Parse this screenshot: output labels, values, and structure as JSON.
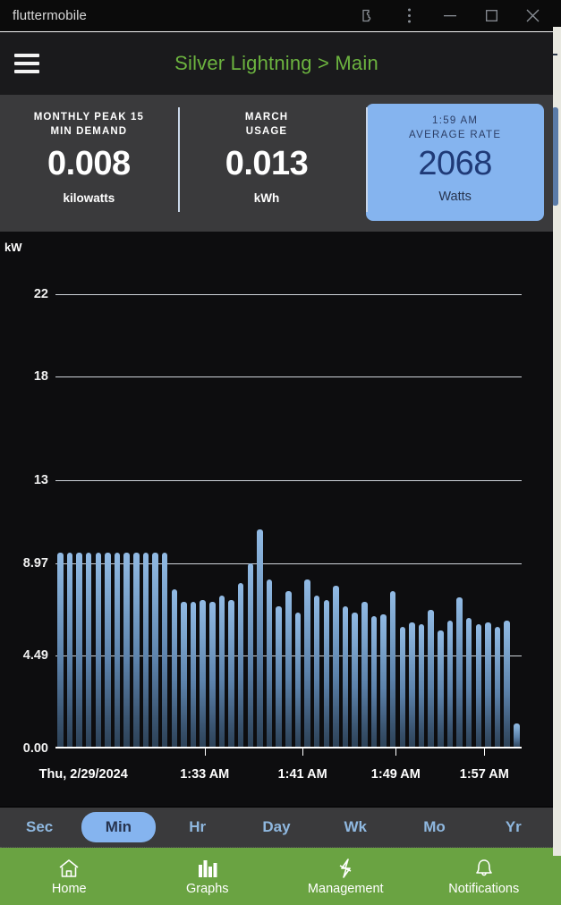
{
  "titlebar": {
    "app_name": "fluttermobile",
    "buttons": [
      {
        "name": "extension-icon",
        "label": ""
      },
      {
        "name": "more-vertical-icon",
        "label": ""
      },
      {
        "name": "minimize-button",
        "label": ""
      },
      {
        "name": "maximize-button",
        "label": ""
      },
      {
        "name": "close-button",
        "label": ""
      }
    ]
  },
  "appbar": {
    "title": "Silver Lightning > Main",
    "title_color": "#6cb33f",
    "menu_icon": "hamburger-icon"
  },
  "stats": [
    {
      "label": "MONTHLY PEAK 15\nMIN DEMAND",
      "label_line1": "MONTHLY PEAK 15",
      "label_line2": "MIN DEMAND",
      "value": "0.008",
      "unit": "kilowatts",
      "highlighted": false
    },
    {
      "label_line1": "MARCH",
      "label_line2": "USAGE",
      "value": "0.013",
      "unit": "kWh",
      "highlighted": false
    },
    {
      "label_line1": "1:59 AM",
      "label_line2": "AVERAGE RATE",
      "value": "2068",
      "unit": "Watts",
      "highlighted": true,
      "bg_color": "#85b4ef"
    }
  ],
  "chart_data": {
    "type": "bar",
    "title": "",
    "xlabel": "",
    "ylabel": "kW",
    "ylim": [
      0,
      24.5
    ],
    "grid": true,
    "legend": null,
    "bar_color": "#8fb8e0",
    "ytick_labels": [
      "22",
      "18",
      "13",
      "8.97",
      "4.49",
      "0.00"
    ],
    "ytick_values": [
      22,
      18,
      13,
      8.97,
      4.49,
      0.0
    ],
    "xtick_labels": [
      "Thu, 2/29/2024",
      "1:33 AM",
      "1:41 AM",
      "1:49 AM",
      "1:57 AM"
    ],
    "xtick_positions": [
      0.06,
      0.32,
      0.53,
      0.73,
      0.92
    ],
    "values": [
      9.5,
      9.5,
      9.5,
      9.5,
      9.5,
      9.5,
      9.5,
      9.5,
      9.5,
      9.5,
      9.5,
      9.5,
      7.7,
      7.1,
      7.1,
      7.2,
      7.1,
      7.4,
      7.2,
      8.0,
      8.97,
      10.6,
      8.2,
      6.9,
      7.6,
      6.6,
      8.2,
      7.4,
      7.2,
      7.9,
      6.9,
      6.6,
      7.1,
      6.4,
      6.5,
      7.6,
      5.9,
      6.1,
      6.0,
      6.7,
      5.7,
      6.2,
      7.3,
      6.3,
      6.0,
      6.1,
      5.9,
      6.2,
      1.2
    ]
  },
  "ranges": [
    {
      "label": "Sec",
      "active": false
    },
    {
      "label": "Min",
      "active": true
    },
    {
      "label": "Hr",
      "active": false
    },
    {
      "label": "Day",
      "active": false
    },
    {
      "label": "Wk",
      "active": false
    },
    {
      "label": "Mo",
      "active": false
    },
    {
      "label": "Yr",
      "active": false
    }
  ],
  "bottom_nav": [
    {
      "label": "Home",
      "icon": "home-icon",
      "active": false
    },
    {
      "label": "Graphs",
      "icon": "bar-chart-icon",
      "active": true
    },
    {
      "label": "Management",
      "icon": "bolt-icon",
      "active": false
    },
    {
      "label": "Notifications",
      "icon": "bell-icon",
      "active": false
    }
  ],
  "colors": {
    "accent_green": "#6aa342",
    "accent_blue": "#85b4ef",
    "card_bg": "#3a3a3c",
    "chart_bg": "#0d0d0f"
  }
}
